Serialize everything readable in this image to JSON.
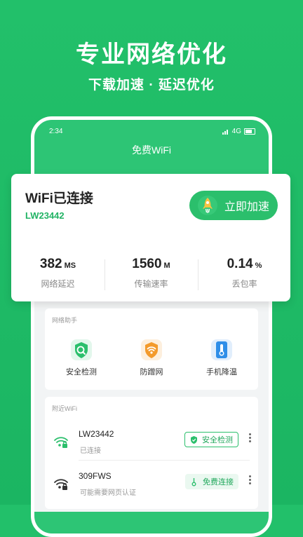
{
  "promo": {
    "title": "专业网络优化",
    "subtitle": "下载加速 · 延迟优化"
  },
  "status_bar": {
    "time": "2:34",
    "network": "4G"
  },
  "app": {
    "title": "免费WiFi"
  },
  "connection": {
    "title": "WiFi已连接",
    "ssid": "LW23442",
    "boost_label": "立即加速",
    "stats": [
      {
        "value": "382",
        "unit": "MS",
        "label": "网络延迟"
      },
      {
        "value": "1560",
        "unit": "M",
        "label": "传输速率"
      },
      {
        "value": "0.14",
        "unit": "%",
        "label": "丢包率"
      }
    ]
  },
  "helper": {
    "title": "网络助手",
    "tools": [
      {
        "label": "安全检测",
        "icon": "shield-check-icon",
        "color": "#2bbf6c"
      },
      {
        "label": "防蹭网",
        "icon": "wifi-shield-icon",
        "color": "#f39a2b"
      },
      {
        "label": "手机降温",
        "icon": "thermometer-icon",
        "color": "#2f8ee8"
      }
    ]
  },
  "nearby": {
    "title": "附近WiFi",
    "items": [
      {
        "ssid": "LW23442",
        "status": "已连接",
        "action": "安全检测"
      },
      {
        "ssid": "309FWS",
        "status": "可能需要网页认证",
        "action": "免费连接"
      }
    ]
  }
}
